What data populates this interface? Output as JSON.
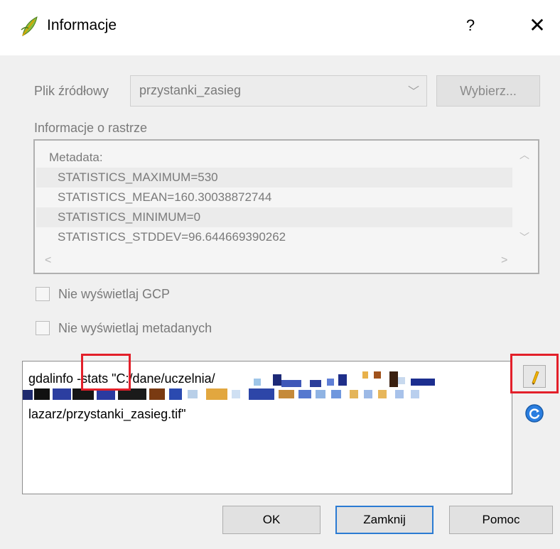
{
  "window": {
    "title": "Informacje",
    "help_label": "?",
    "close_label": "✕",
    "icon": "qgis-leaf-icon"
  },
  "source": {
    "label": "Plik źródłowy",
    "selected": "przystanki_zasieg",
    "browse_label": "Wybierz..."
  },
  "raster_info": {
    "label": "Informacje o rastrze",
    "lines": [
      "Metadata:",
      "  STATISTICS_MAXIMUM=530",
      "  STATISTICS_MEAN=160.30038872744",
      "  STATISTICS_MINIMUM=0",
      "  STATISTICS_STDDEV=96.644669390262"
    ]
  },
  "options": {
    "no_gcp_label": "Nie wyświetlaj GCP",
    "no_gcp_checked": false,
    "no_metadata_label": "Nie wyświetlaj metadanych",
    "no_metadata_checked": false
  },
  "command": {
    "part1": "gdalinfo",
    "part2": "-stats",
    "part3": "\"C:/dane/uczelnia/",
    "line3": "lazarz/przystanki_zasieg.tif\""
  },
  "buttons": {
    "ok": "OK",
    "close": "Zamknij",
    "help": "Pomoc"
  },
  "colors": {
    "highlight": "#e3202a",
    "default_button_border": "#2b7bd3",
    "edit_icon": "#f2b400",
    "reset_icon": "#2a7ee0"
  }
}
